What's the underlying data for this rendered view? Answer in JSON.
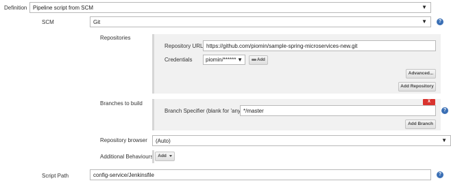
{
  "definition": {
    "label": "Definition",
    "selected": "Pipeline script from SCM"
  },
  "scm": {
    "label": "SCM",
    "selected": "Git"
  },
  "repositories": {
    "label": "Repositories",
    "url_label": "Repository URL",
    "url_value": "https://github.com/piomin/sample-spring-microservices-new.git",
    "credentials_label": "Credentials",
    "credentials_selected": "piomin/******",
    "add_label": "Add",
    "advanced_label": "Advanced...",
    "add_repository_label": "Add Repository"
  },
  "branches": {
    "label": "Branches to build",
    "delete_label": "X",
    "specifier_label": "Branch Specifier (blank for 'any')",
    "specifier_value": "*/master",
    "add_branch_label": "Add Branch"
  },
  "repository_browser": {
    "label": "Repository browser",
    "selected": "(Auto)"
  },
  "additional_behaviours": {
    "label": "Additional Behaviours",
    "add_label": "Add"
  },
  "script_path": {
    "label": "Script Path",
    "value": "config-service/Jenkinsfile"
  },
  "help_glyph": "?",
  "dropdown_glyph": "▼",
  "icons": {
    "help": "help-icon",
    "dropdown": "dropdown-arrow-icon",
    "key": "key-icon"
  },
  "colors": {
    "help": "#3a6fb5",
    "delete": "#d9332e",
    "panel": "#f1f1f1"
  }
}
